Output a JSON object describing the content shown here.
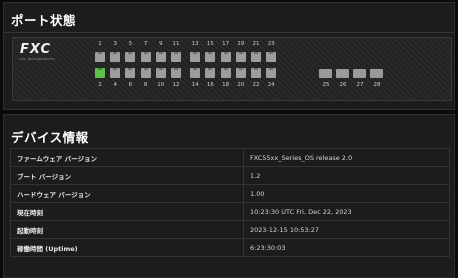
{
  "port_status": {
    "title": "ポート状態",
    "logo": "FXC",
    "logo_sub": "FXC INCORPORATED",
    "top_port_labels": [
      "1",
      "3",
      "5",
      "7",
      "9",
      "11",
      "13",
      "15",
      "17",
      "19",
      "21",
      "23"
    ],
    "bottom_port_labels": [
      "2",
      "4",
      "6",
      "8",
      "10",
      "12",
      "14",
      "16",
      "18",
      "20",
      "22",
      "24"
    ],
    "sfp_labels": [
      "25",
      "26",
      "27",
      "28"
    ],
    "ports_up": [
      "2"
    ],
    "colors": {
      "port_up": "#5fc04a",
      "port_down": "#9d9d9d"
    }
  },
  "device_info": {
    "title": "デバイス情報",
    "rows": [
      {
        "key": "ファームウェア バージョン",
        "value": "FXC55xx_Series_OS release 2.0"
      },
      {
        "key": "ブート バージョン",
        "value": "1.2"
      },
      {
        "key": "ハードウェア バージョン",
        "value": "1.00"
      },
      {
        "key": "現在時刻",
        "value": "10:23:30 UTC Fri, Dec 22, 2023"
      },
      {
        "key": "起動時刻",
        "value": "2023-12-15 10:53:27"
      },
      {
        "key": "稼働時間 (Uptime)",
        "value": "6:23:30:03"
      }
    ]
  }
}
